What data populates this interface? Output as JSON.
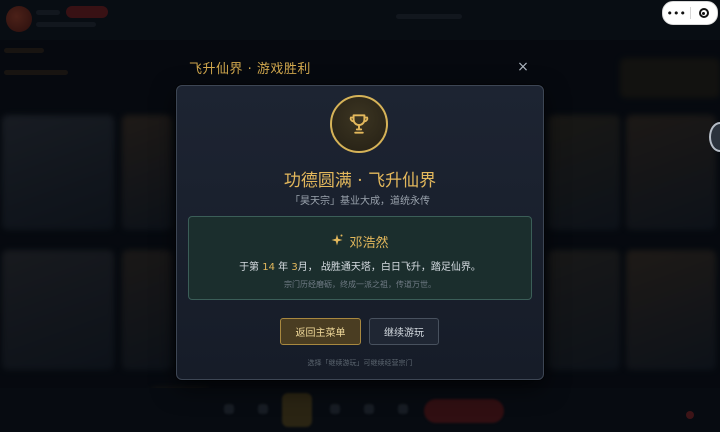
{
  "dialog": {
    "title": "飞升仙界 · 游戏胜利",
    "close_label": "×",
    "headline": "功德圆满 · 飞升仙界",
    "subline": "「昊天宗」基业大成，道统永传",
    "result": {
      "hero_name": "邓浩然",
      "feat_prefix": "于第",
      "year": "14",
      "year_unit": "年",
      "month": "3",
      "month_unit": "月，",
      "feat_suffix": "战胜通天塔，白日飞升，踏足仙界。",
      "note": "宗门历经磨砺，终成一派之祖，传道万世。"
    },
    "buttons": {
      "menu": "返回主菜单",
      "continue": "继续游玩"
    },
    "hint": "选择「继续游玩」可继续经营宗门"
  },
  "capsule": {
    "more_label": "•••"
  },
  "icons": {
    "trophy": "trophy-icon",
    "hero": "sparkle-icon",
    "close": "close-icon"
  },
  "colors": {
    "accent_gold": "#e3b85c",
    "panel_bg": "#1d2432",
    "result_bg": "#1b2e2d",
    "result_border": "#3b5e58"
  }
}
